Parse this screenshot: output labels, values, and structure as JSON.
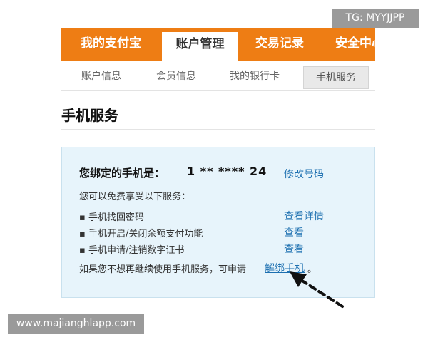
{
  "watermark_top": "TG: MYYJJPP",
  "watermark_bottom": "www.majianghlapp.com",
  "tabs": [
    {
      "label": "我的支付宝"
    },
    {
      "label": "账户管理"
    },
    {
      "label": "交易记录"
    },
    {
      "label": "安全中心"
    }
  ],
  "subnav": [
    {
      "label": "账户信息"
    },
    {
      "label": "会员信息"
    },
    {
      "label": "我的银行卡"
    },
    {
      "label": "手机服务"
    }
  ],
  "page_title": "手机服务",
  "panel": {
    "bound_label": "您绑定的手机是：",
    "phone_number": "1 ** ****  24",
    "modify_link": "修改号码",
    "intro": "您可以免费享受以下服务：",
    "services": [
      {
        "text": "手机找回密码",
        "link": "查看详情"
      },
      {
        "text": "手机开启/关闭余额支付功能",
        "link": "查看"
      },
      {
        "text": "手机申请/注销数字证书",
        "link": "查看"
      }
    ],
    "bullet": "▪",
    "footer_text": "如果您不想再继续使用手机服务，可申请",
    "unbind_link": "解绑手机",
    "footer_period": "。"
  },
  "colors": {
    "tab_bar": "#ee7d14",
    "panel_bg": "#e7f4fb",
    "link": "#1c6fb0"
  },
  "icons": {
    "arrow": "dashed-arrow-icon"
  }
}
